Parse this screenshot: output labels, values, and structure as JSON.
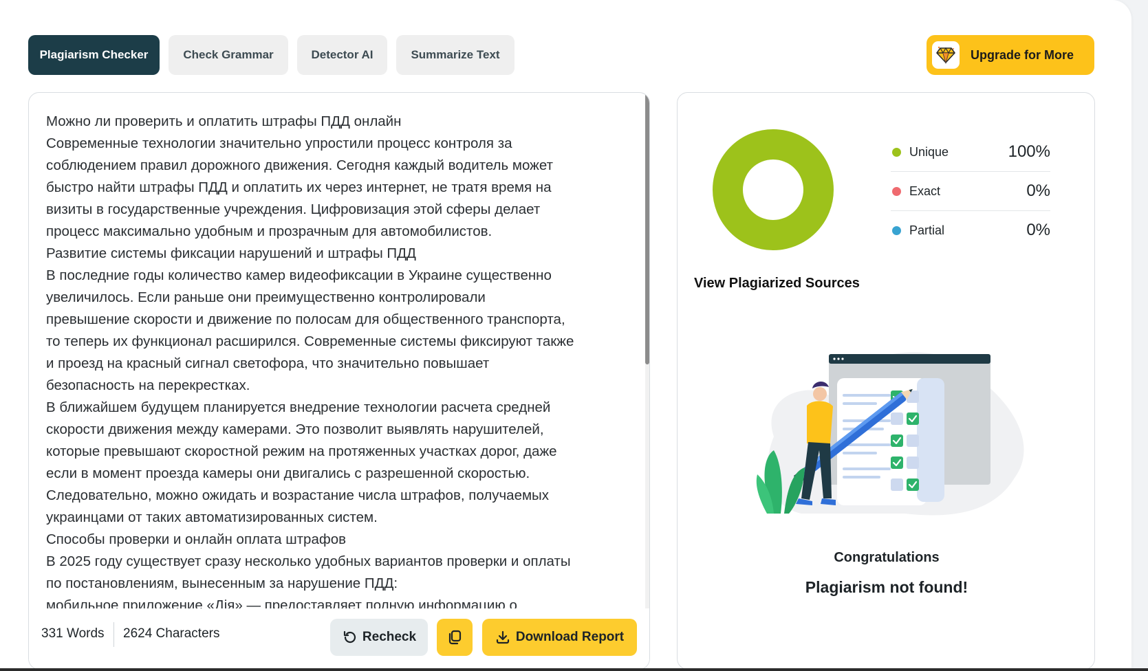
{
  "tabs": [
    {
      "label": "Plagiarism Checker",
      "active": true
    },
    {
      "label": "Check Grammar",
      "active": false
    },
    {
      "label": "Detector AI",
      "active": false
    },
    {
      "label": "Summarize Text",
      "active": false
    }
  ],
  "upgrade": {
    "label": "Upgrade for More",
    "icon": "diamond-icon"
  },
  "editor": {
    "lines": [
      "Можно ли проверить и оплатить штрафы ПДД онлайн",
      "Современные технологии значительно упростили процесс контроля за",
      "соблюдением правил дорожного движения. Сегодня каждый водитель может",
      "быстро найти штрафы ПДД и оплатить их через интернет, не тратя время на",
      "визиты в государственные учреждения. Цифровизация этой сферы делает",
      "процесс максимально удобным и прозрачным для автомобилистов.",
      "Развитие системы фиксации нарушений и штрафы ПДД",
      "В последние годы количество камер видеофиксации в Украине существенно",
      "увеличилось. Если раньше они преимущественно контролировали",
      "превышение скорости и движение по полосам для общественного транспорта,",
      "то теперь их функционал расширился. Современные системы фиксируют также",
      "и проезд на красный сигнал светофора, что значительно повышает",
      "безопасность на перекрестках.",
      "В ближайшем будущем планируется внедрение технологии расчета средней",
      "скорости движения между камерами. Это позволит выявлять нарушителей,",
      "которые превышают скоростной режим на протяженных участках дорог, даже",
      "если в момент проезда камеры они двигались с разрешенной скоростью.",
      "Следовательно, можно ожидать и возрастание числа штрафов, получаемых",
      "украинцами от таких автоматизированных систем.",
      "Способы проверки и онлайн оплата штрафов",
      "В 2025 году существует сразу несколько удобных вариантов проверки и оплаты",
      "по постановлениям, вынесенным за нарушение ПДД:",
      "мобильное приложение «Дія» — предоставляет полную информацию о"
    ],
    "words": "331 Words",
    "characters": "2624 Characters",
    "recheck_label": "Recheck",
    "download_label": "Download Report"
  },
  "results": {
    "legend": [
      {
        "label": "Unique",
        "value": "100%",
        "color": "#9dc21b",
        "fraction": 1.0
      },
      {
        "label": "Exact",
        "value": "0%",
        "color": "#ef6a6f",
        "fraction": 0.0
      },
      {
        "label": "Partial",
        "value": "0%",
        "color": "#38a3d1",
        "fraction": 0.0
      }
    ],
    "view_sources": "View Plagiarized Sources",
    "congrats": "Congratulations",
    "not_found": "Plagiarism not found!"
  }
}
